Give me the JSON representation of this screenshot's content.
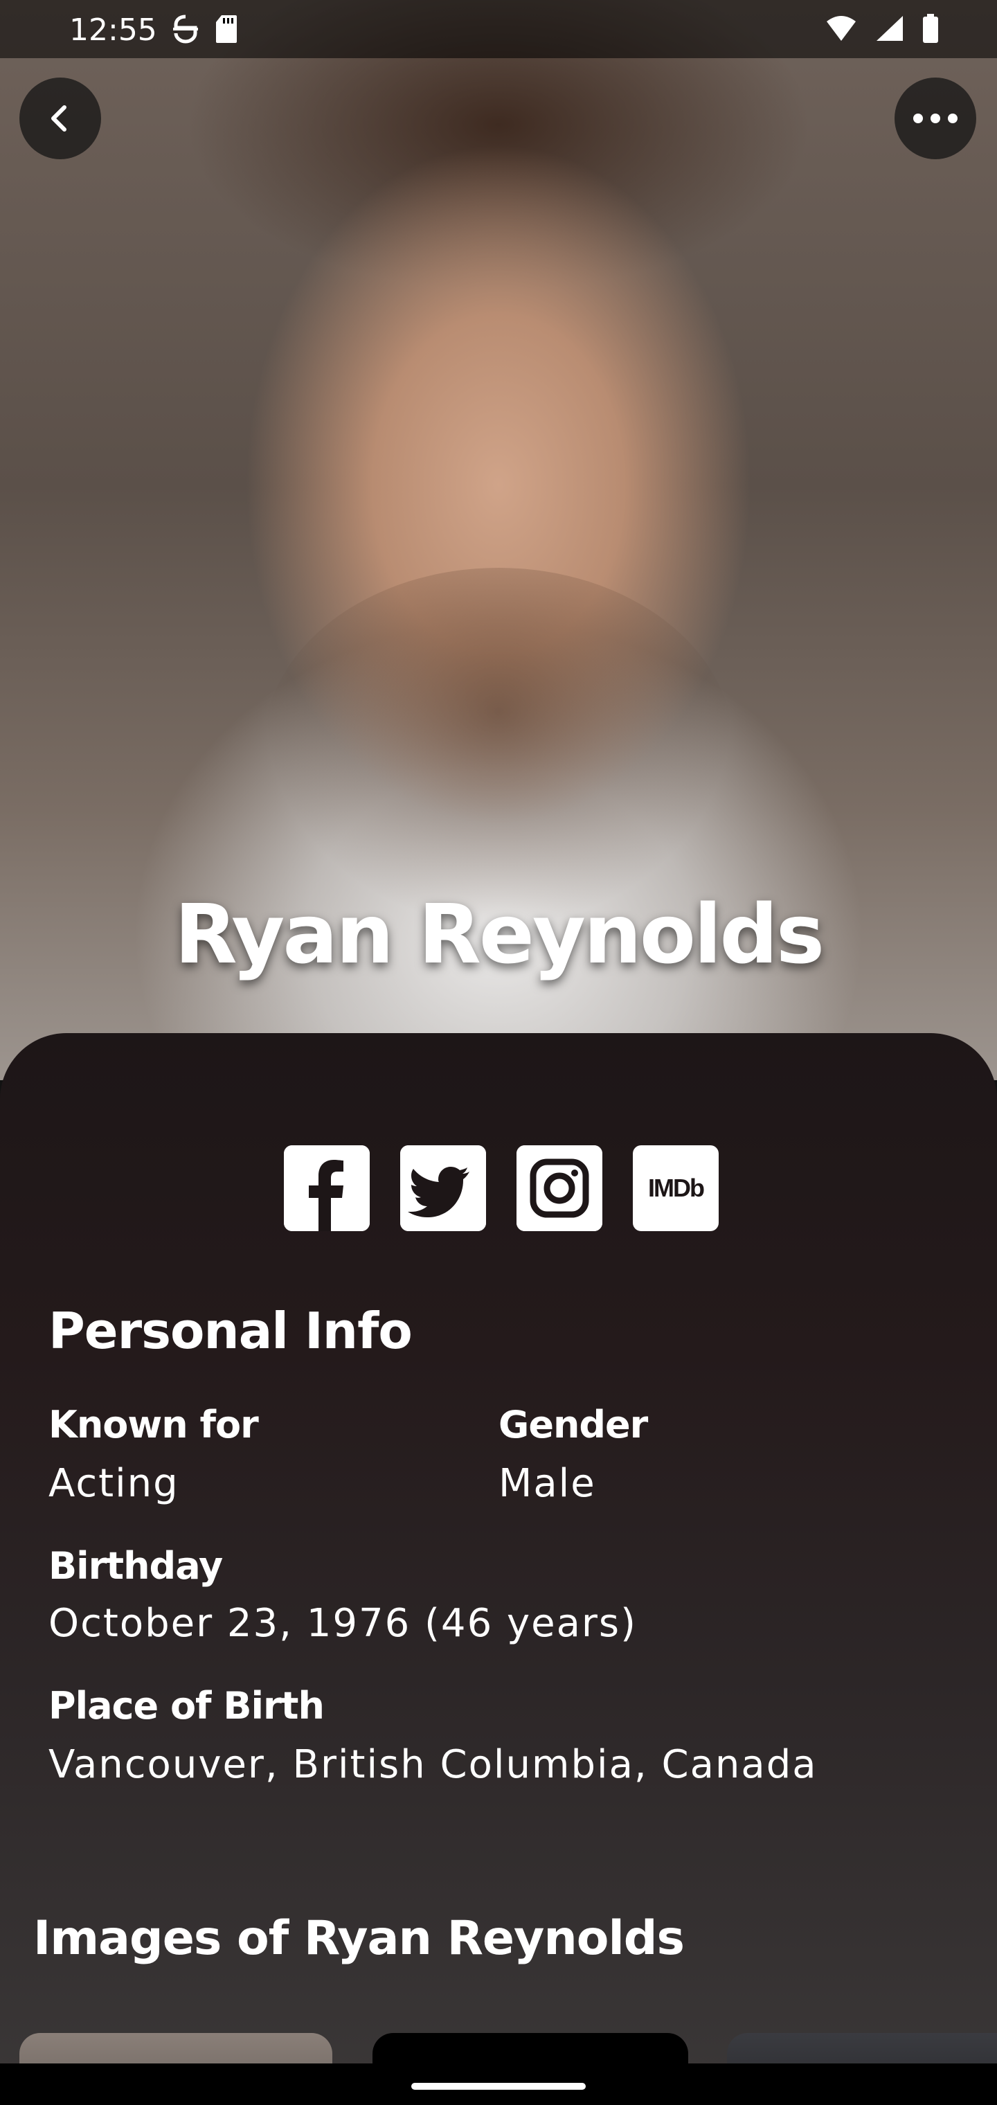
{
  "status_bar": {
    "time": "12:55"
  },
  "hero": {
    "actor_name": "Ryan Reynolds",
    "back_icon": "back-arrow-icon",
    "more_icon": "more-options-icon"
  },
  "socials": [
    {
      "name": "facebook",
      "icon": "facebook-icon"
    },
    {
      "name": "twitter",
      "icon": "twitter-icon"
    },
    {
      "name": "instagram",
      "icon": "instagram-icon"
    },
    {
      "name": "imdb",
      "icon": "imdb-icon",
      "label": "IMDb"
    }
  ],
  "personal_info": {
    "title": "Personal Info",
    "known_for_label": "Known for",
    "known_for_value": "Acting",
    "gender_label": "Gender",
    "gender_value": "Male",
    "birthday_label": "Birthday",
    "birthday_value": "October 23, 1976 (46 years)",
    "place_of_birth_label": "Place of Birth",
    "place_of_birth_value": "Vancouver, British Columbia, Canada"
  },
  "images_section": {
    "title": "Images of Ryan Reynolds"
  }
}
